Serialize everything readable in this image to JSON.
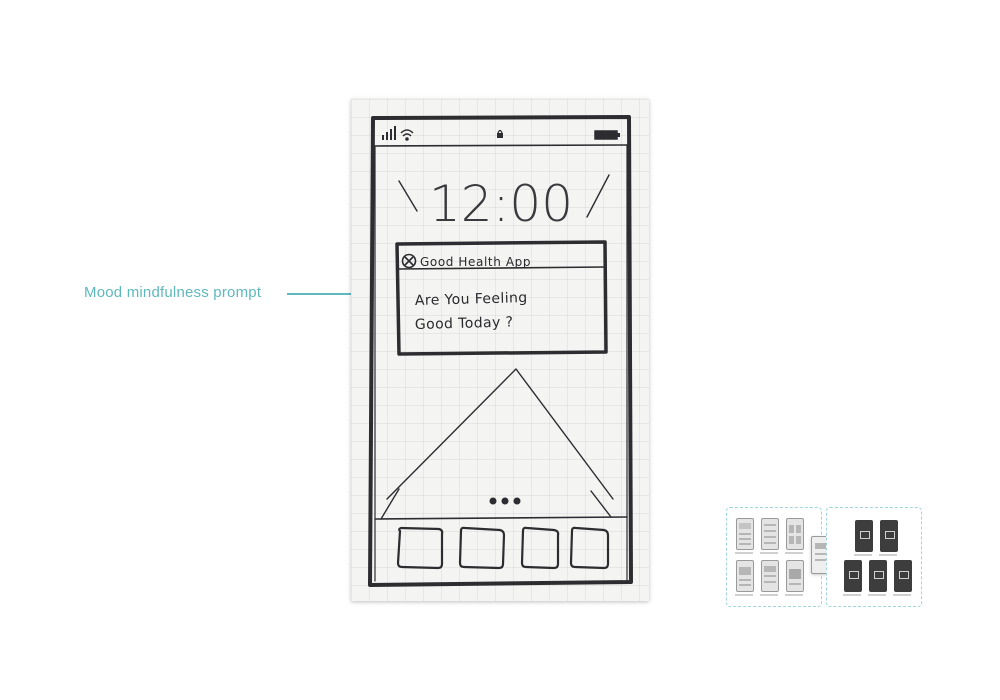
{
  "annotation": {
    "label": "Mood mindfulness prompt",
    "color": "#5fb8bd"
  },
  "sketch": {
    "clock": "12:00",
    "notification": {
      "app_name": "Good Health App",
      "message_line1": "Are You Feeling",
      "message_line2": "Good Today ?"
    },
    "status_icons": [
      "signal-icon",
      "wifi-icon",
      "lock-icon",
      "battery-icon"
    ],
    "dock_icon_count": 4
  }
}
